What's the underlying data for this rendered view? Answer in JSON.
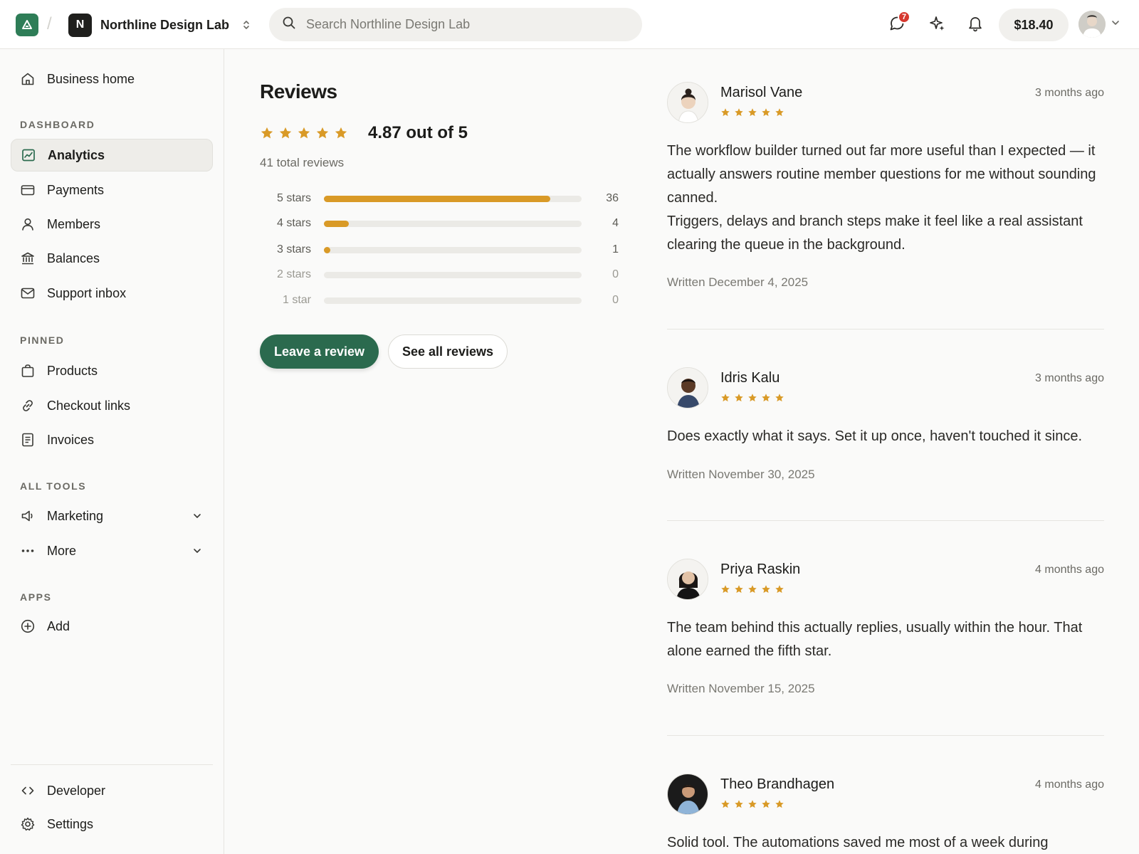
{
  "org": {
    "initial": "N",
    "name": "Northline Design Lab"
  },
  "search": {
    "placeholder": "Search Northline Design Lab"
  },
  "topbar": {
    "chat_badge": "7",
    "balance": "$18.40"
  },
  "sidebar": {
    "home": "Business home",
    "sections": {
      "dashboard": "DASHBOARD",
      "pinned": "PINNED",
      "all_tools": "ALL TOOLS",
      "apps": "APPS"
    },
    "dashboard_items": [
      {
        "label": "Analytics",
        "icon": "chart-icon",
        "active": true
      },
      {
        "label": "Payments",
        "icon": "card-icon"
      },
      {
        "label": "Members",
        "icon": "user-icon"
      },
      {
        "label": "Balances",
        "icon": "bank-icon"
      },
      {
        "label": "Support inbox",
        "icon": "mail-icon"
      }
    ],
    "pinned_items": [
      {
        "label": "Products",
        "icon": "bag-icon"
      },
      {
        "label": "Checkout links",
        "icon": "link-icon"
      },
      {
        "label": "Invoices",
        "icon": "document-icon"
      }
    ],
    "tools_items": [
      {
        "label": "Marketing",
        "icon": "megaphone-icon"
      },
      {
        "label": "More",
        "icon": "more-icon"
      }
    ],
    "apps_items": [
      {
        "label": "Add",
        "icon": "plus-circle-icon"
      }
    ],
    "footer_items": [
      {
        "label": "Developer",
        "icon": "code-icon"
      },
      {
        "label": "Settings",
        "icon": "gear-icon"
      }
    ]
  },
  "summary": {
    "title": "Reviews",
    "average_text": "4.87 out of 5",
    "average": 4.87,
    "total_text": "41 total reviews",
    "distribution": [
      {
        "label": "5 stars",
        "count": 36
      },
      {
        "label": "4 stars",
        "count": 4
      },
      {
        "label": "3 stars",
        "count": 1
      },
      {
        "label": "2 stars",
        "count": 0
      },
      {
        "label": "1 star",
        "count": 0
      }
    ],
    "total": 41,
    "primary_button": "Leave a review",
    "secondary_button": "See all reviews"
  },
  "reviews": [
    {
      "name": "Marisol Vane",
      "time": "3 months ago",
      "rating": 5,
      "paragraphs": [
        "The workflow builder turned out far more useful than I expected — it actually answers routine member questions for me without sounding canned.",
        "Triggers, delays and branch steps make it feel like a real assistant clearing the queue in the background."
      ],
      "date": "Written December 4, 2025"
    },
    {
      "name": "Idris Kalu",
      "time": "3 months ago",
      "rating": 5,
      "paragraphs": [
        "Does exactly what it says. Set it up once, haven't touched it since."
      ],
      "date": "Written November 30, 2025"
    },
    {
      "name": "Priya Raskin",
      "time": "4 months ago",
      "rating": 5,
      "paragraphs": [
        "The team behind this actually replies, usually within the hour. That alone earned the fifth star."
      ],
      "date": "Written November 15, 2025"
    },
    {
      "name": "Theo Brandhagen",
      "time": "4 months ago",
      "rating": 5,
      "paragraphs": [
        "Solid tool. The automations saved me most of a week during"
      ],
      "date": ""
    }
  ],
  "colors": {
    "accent": "#2b6a4e",
    "star": "#d99a27",
    "badge": "#d6382f"
  }
}
